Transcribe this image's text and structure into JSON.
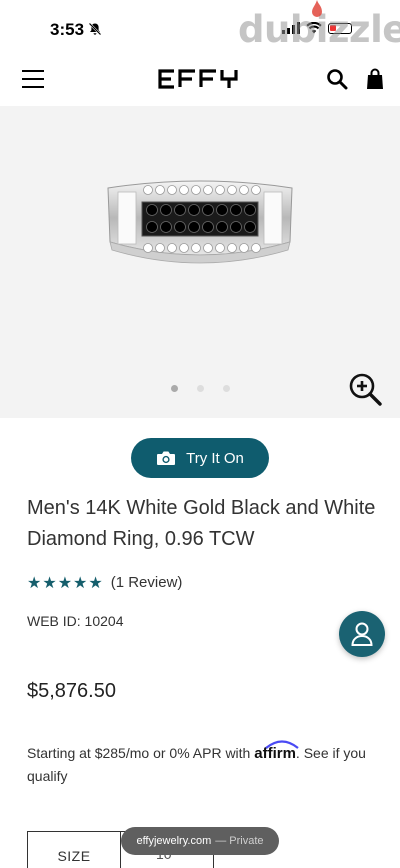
{
  "status_bar": {
    "time": "3:53",
    "watermark": "dubizzle"
  },
  "header": {
    "logo_text": "EFFY"
  },
  "gallery": {
    "image_count": 3,
    "active_index": 0
  },
  "try_on": {
    "label": "Try It On"
  },
  "product": {
    "title": "Men's 14K White Gold Black and White Diamond Ring, 0.96 TCW",
    "rating_stars": 5,
    "reviews_label": "(1 Review)",
    "web_id": "WEB ID: 10204",
    "price": "$5,876.50"
  },
  "financing": {
    "prefix": "Starting at $285/mo or 0% APR with ",
    "brand": "affirm",
    "suffix": ". See if you qualify"
  },
  "size": {
    "label": "SIZE",
    "value": "10"
  },
  "browser": {
    "domain": "effyjewelry.com",
    "mode": "— Private"
  },
  "colors": {
    "accent": "#0f5c6e",
    "star": "#155e6c"
  }
}
